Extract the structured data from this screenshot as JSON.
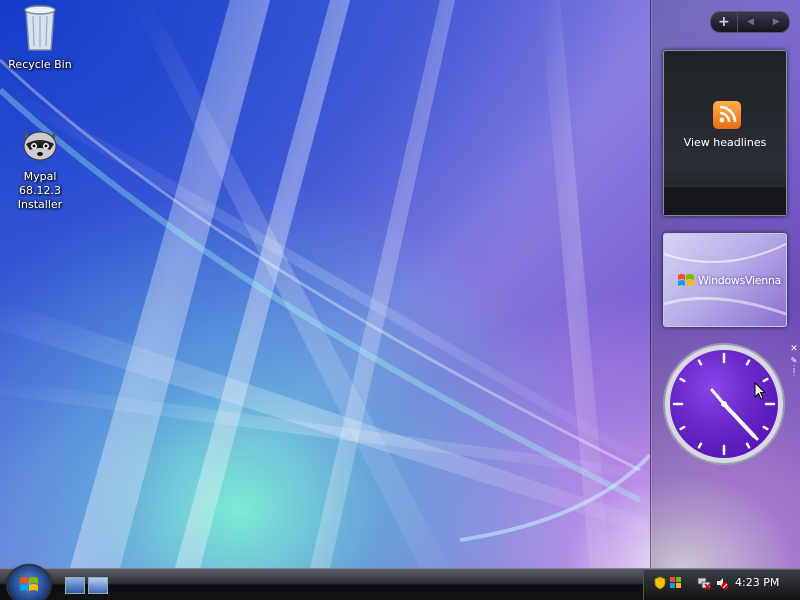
{
  "desktop": {
    "icons": [
      {
        "label": "Recycle Bin",
        "icon": "recycle-bin-icon"
      },
      {
        "label": "Mypal 68.12.3 Installer",
        "icon": "raccoon-installer-icon"
      }
    ]
  },
  "sidebar": {
    "controls": {
      "add": "+",
      "prev": "◀",
      "next": "▶"
    },
    "feed_gadget": {
      "label": "View headlines",
      "icon": "rss-icon"
    },
    "slideshow_gadget": {
      "text": "WindowsVienna",
      "icon": "windows-flag-icon"
    },
    "clock_gadget": {
      "time": "4:23",
      "close": "✕",
      "options": "🔧"
    }
  },
  "taskbar": {
    "start": {
      "icon": "windows-orb-icon"
    },
    "quick_launch": [
      "show-desktop-icon",
      "switch-windows-icon"
    ],
    "tray": {
      "icons": [
        "security-shield-icon",
        "windows-update-icon",
        "network-disconnected-icon",
        "volume-muted-icon"
      ],
      "time": "4:23 PM"
    }
  },
  "colors": {
    "accent_purple": "#6a1fd0",
    "rss_orange": "#f18a1e"
  }
}
